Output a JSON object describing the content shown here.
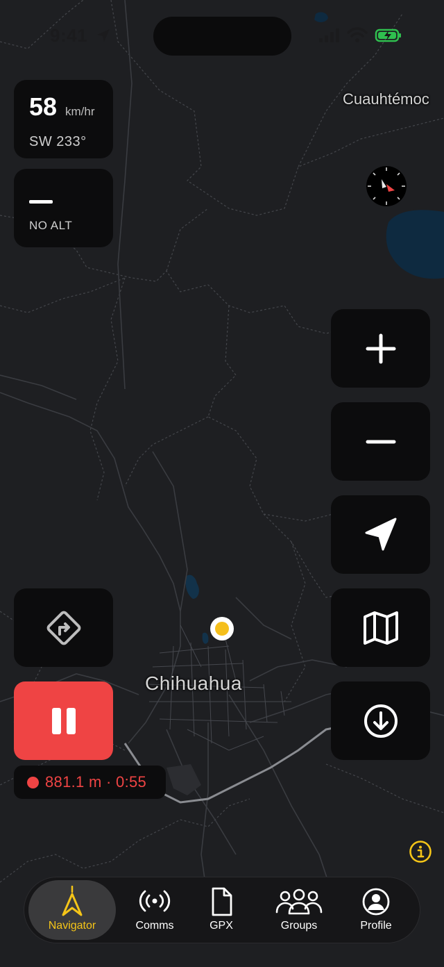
{
  "status_bar": {
    "time": "9:41",
    "icons": [
      "location-arrow-icon",
      "cellular-signal-icon",
      "wifi-icon",
      "battery-charging-icon"
    ]
  },
  "speed": {
    "value": "58",
    "unit": "km/hr",
    "heading": "SW 233°"
  },
  "altitude": {
    "value_icon": "dash-icon",
    "label": "NO ALT"
  },
  "map": {
    "labels": {
      "cuauhtemoc": "Cuauhtémoc",
      "chihuahua": "Chihuahua"
    },
    "user_location_color": "#f5bf1c"
  },
  "controls": [
    "zoom-in-icon",
    "zoom-out-icon",
    "navigation-arrow-icon",
    "map-icon",
    "download-icon",
    "compass-icon",
    "route-turn-icon",
    "info-icon"
  ],
  "recording": {
    "button_color": "#ef4444",
    "summary": "881.1 m · 0:55"
  },
  "tabs": [
    {
      "label": "Navigator",
      "icon": "navigator-icon",
      "active": true
    },
    {
      "label": "Comms",
      "icon": "broadcast-icon",
      "active": false
    },
    {
      "label": "GPX",
      "icon": "file-icon",
      "active": false
    },
    {
      "label": "Groups",
      "icon": "groups-icon",
      "active": false
    },
    {
      "label": "Profile",
      "icon": "profile-icon",
      "active": false
    }
  ],
  "colors": {
    "accent": "#f5c518",
    "record": "#ef4444",
    "panel": "#0c0c0d",
    "map_background": "#1e1f22"
  }
}
